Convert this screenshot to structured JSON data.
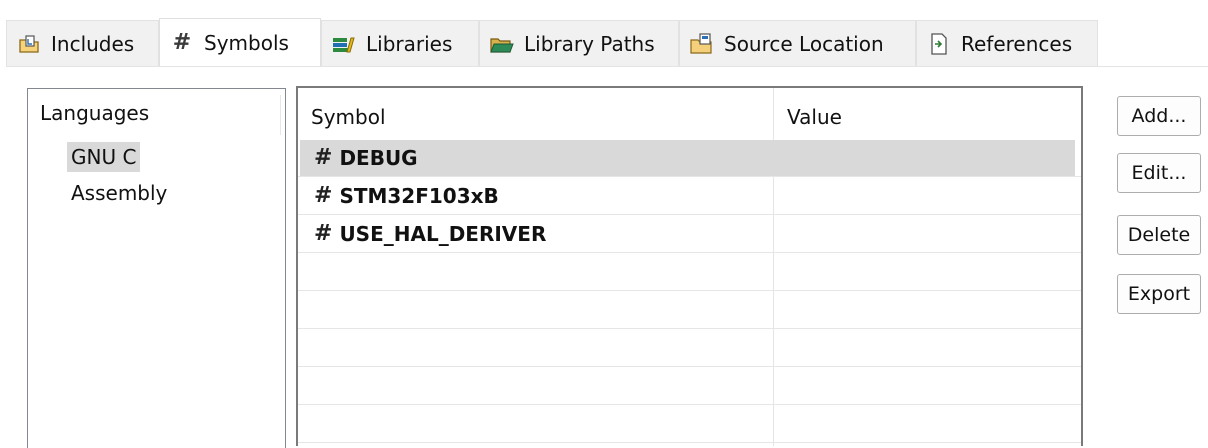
{
  "tabs": [
    {
      "label": "Includes",
      "icon": "includes-icon"
    },
    {
      "label": "Symbols",
      "icon": "hash-icon"
    },
    {
      "label": "Libraries",
      "icon": "libraries-icon"
    },
    {
      "label": "Library Paths",
      "icon": "folder-icon"
    },
    {
      "label": "Source Location",
      "icon": "source-folder-icon"
    },
    {
      "label": "References",
      "icon": "references-icon"
    }
  ],
  "languages": {
    "header": "Languages",
    "items": [
      "GNU C",
      "Assembly"
    ],
    "selected": "GNU C"
  },
  "table": {
    "columns": [
      "Symbol",
      "Value"
    ],
    "rows": [
      {
        "symbol": "DEBUG",
        "value": ""
      },
      {
        "symbol": "STM32F103xB",
        "value": ""
      },
      {
        "symbol": "USE_HAL_DERIVER",
        "value": ""
      }
    ],
    "row_prefix": "#",
    "selected_row": "DEBUG"
  },
  "buttons": {
    "add": "Add...",
    "edit": "Edit...",
    "delete": "Delete",
    "export": "Export"
  },
  "colors": {
    "selection": "#d9d9d9",
    "border": "#7a7a7a"
  }
}
